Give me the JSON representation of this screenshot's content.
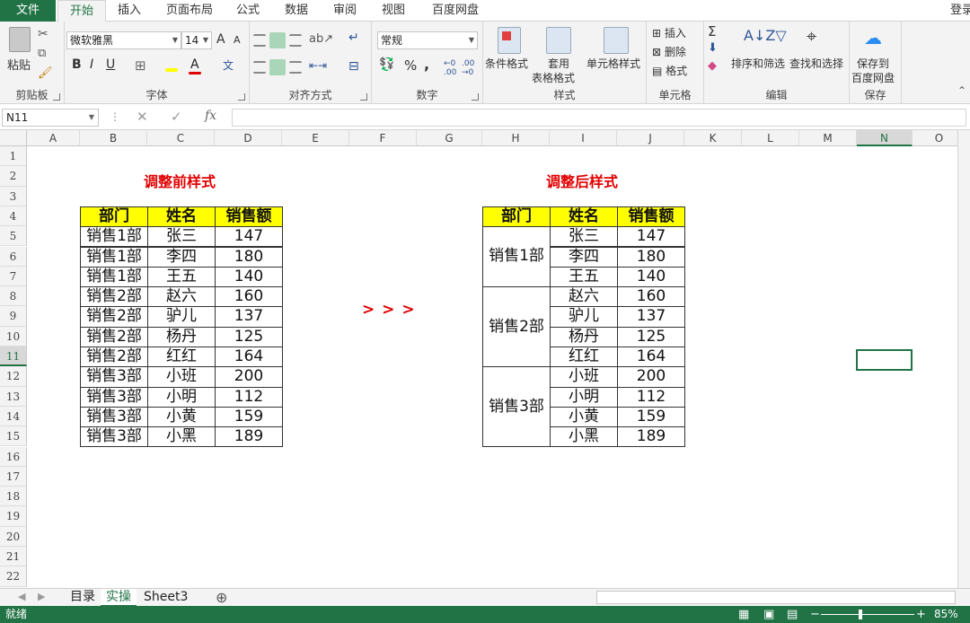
{
  "menu": {
    "items": [
      "文件",
      "开始",
      "插入",
      "页面布局",
      "公式",
      "数据",
      "审阅",
      "视图",
      "百度网盘"
    ],
    "login": "登录"
  },
  "ribbon": {
    "clipboard": {
      "paste": "粘贴",
      "label": "剪贴板"
    },
    "font": {
      "name": "微软雅黑",
      "size": "14",
      "bold": "B",
      "italic": "I",
      "underline": "U",
      "label": "字体",
      "grow": "A",
      "shrink": "A"
    },
    "align": {
      "label": "对齐方式"
    },
    "number": {
      "format": "常规",
      "percent": "%",
      "comma": ",",
      "label": "数字"
    },
    "styles": {
      "cond": "条件格式",
      "table1": "套用",
      "table2": "表格格式",
      "cell": "单元格样式",
      "label": "样式"
    },
    "cells": {
      "insert": "插入",
      "delete": "删除",
      "format": "格式",
      "label": "单元格"
    },
    "edit": {
      "sort": "排序和筛选",
      "find": "查找和选择",
      "label": "编辑"
    },
    "save": {
      "line1": "保存到",
      "line2": "百度网盘",
      "label": "保存"
    }
  },
  "formula": {
    "namebox": "N11",
    "fx": "fx"
  },
  "columns": [
    "A",
    "B",
    "C",
    "D",
    "E",
    "F",
    "G",
    "H",
    "I",
    "J",
    "K",
    "L",
    "M",
    "N",
    "O"
  ],
  "rows": [
    "1",
    "2",
    "3",
    "4",
    "5",
    "6",
    "7",
    "8",
    "9",
    "10",
    "11",
    "12",
    "13",
    "14",
    "15",
    "16",
    "17",
    "18",
    "19",
    "20",
    "21",
    "22"
  ],
  "left_table": {
    "title": "调整前样式",
    "headers": [
      "部门",
      "姓名",
      "销售额"
    ],
    "rows": [
      [
        "销售1部",
        "张三",
        "147"
      ],
      [
        "销售1部",
        "李四",
        "180"
      ],
      [
        "销售1部",
        "王五",
        "140"
      ],
      [
        "销售2部",
        "赵六",
        "160"
      ],
      [
        "销售2部",
        "驴儿",
        "137"
      ],
      [
        "销售2部",
        "杨丹",
        "125"
      ],
      [
        "销售2部",
        "红红",
        "164"
      ],
      [
        "销售3部",
        "小班",
        "200"
      ],
      [
        "销售3部",
        "小明",
        "112"
      ],
      [
        "销售3部",
        "小黄",
        "159"
      ],
      [
        "销售3部",
        "小黑",
        "189"
      ]
    ]
  },
  "arrow": "> > >",
  "right_table": {
    "title": "调整后样式",
    "headers": [
      "部门",
      "姓名",
      "销售额"
    ],
    "groups": [
      {
        "dept": "销售1部",
        "rows": [
          [
            "张三",
            "147"
          ],
          [
            "李四",
            "180"
          ],
          [
            "王五",
            "140"
          ]
        ]
      },
      {
        "dept": "销售2部",
        "rows": [
          [
            "赵六",
            "160"
          ],
          [
            "驴儿",
            "137"
          ],
          [
            "杨丹",
            "125"
          ],
          [
            "红红",
            "164"
          ]
        ]
      },
      {
        "dept": "销售3部",
        "rows": [
          [
            "小班",
            "200"
          ],
          [
            "小明",
            "112"
          ],
          [
            "小黄",
            "159"
          ],
          [
            "小黑",
            "189"
          ]
        ]
      }
    ]
  },
  "sheets": {
    "tabs": [
      "目录",
      "实操",
      "Sheet3"
    ],
    "active": 1,
    "add": "⊕"
  },
  "status": {
    "ready": "就绪",
    "zoom": "85%"
  },
  "colors": {
    "excel_green": "#217346",
    "header_yellow": "#ffff00",
    "title_red": "#e10000"
  }
}
